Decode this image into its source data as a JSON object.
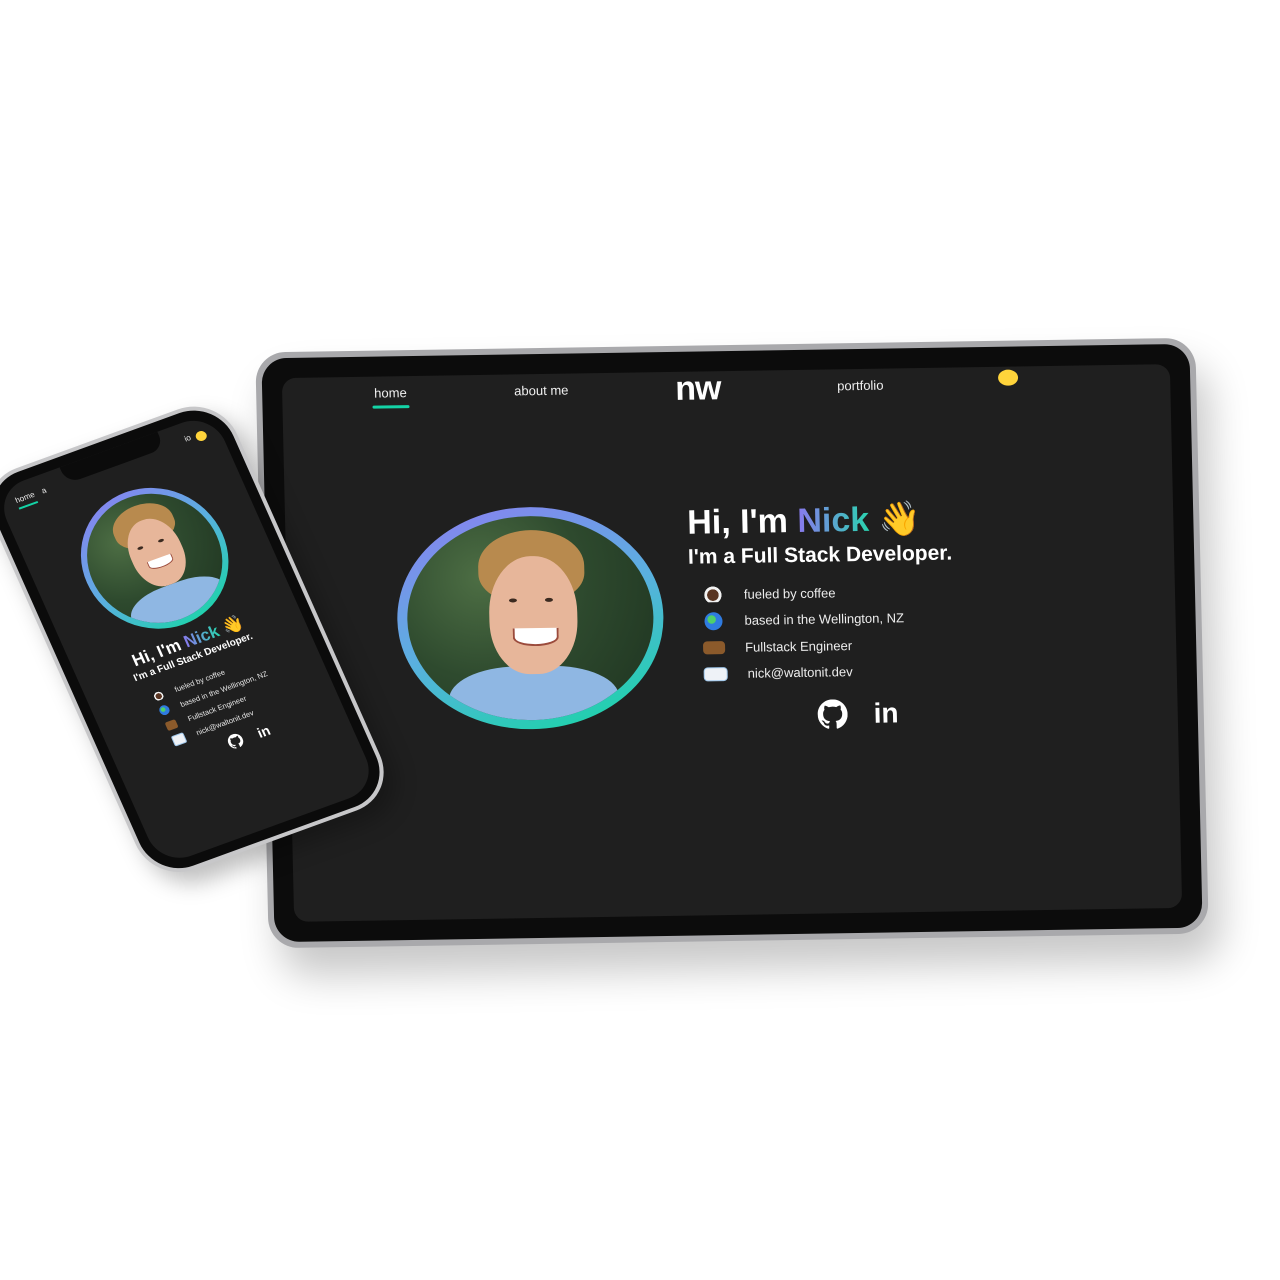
{
  "site": {
    "logo": "nw",
    "nav": [
      "home",
      "about me",
      "portfolio"
    ],
    "phone_nav_visible": [
      "home",
      "a",
      "io"
    ],
    "theme_toggle_icon": "sun-icon",
    "accent_colors": {
      "nav_underline": "#14d3a6",
      "gradient_start": "#8a78ee",
      "gradient_end": "#2ad4b0",
      "theme": "#ffd43b"
    }
  },
  "hero": {
    "greeting_prefix": "Hi, I'm ",
    "name": "Nick",
    "wave": "👋",
    "subtitle": "I'm a Full Stack Developer.",
    "facts": [
      {
        "icon": "coffee-icon",
        "text": "fueled by coffee"
      },
      {
        "icon": "globe-icon",
        "text": "based in the Wellington, NZ"
      },
      {
        "icon": "briefcase-icon",
        "text": "Fullstack Engineer"
      },
      {
        "icon": "envelope-icon",
        "text": "nick@waltonit.dev"
      }
    ],
    "social": [
      {
        "icon": "github-icon"
      },
      {
        "icon": "linkedin-icon",
        "text": "in"
      }
    ]
  }
}
